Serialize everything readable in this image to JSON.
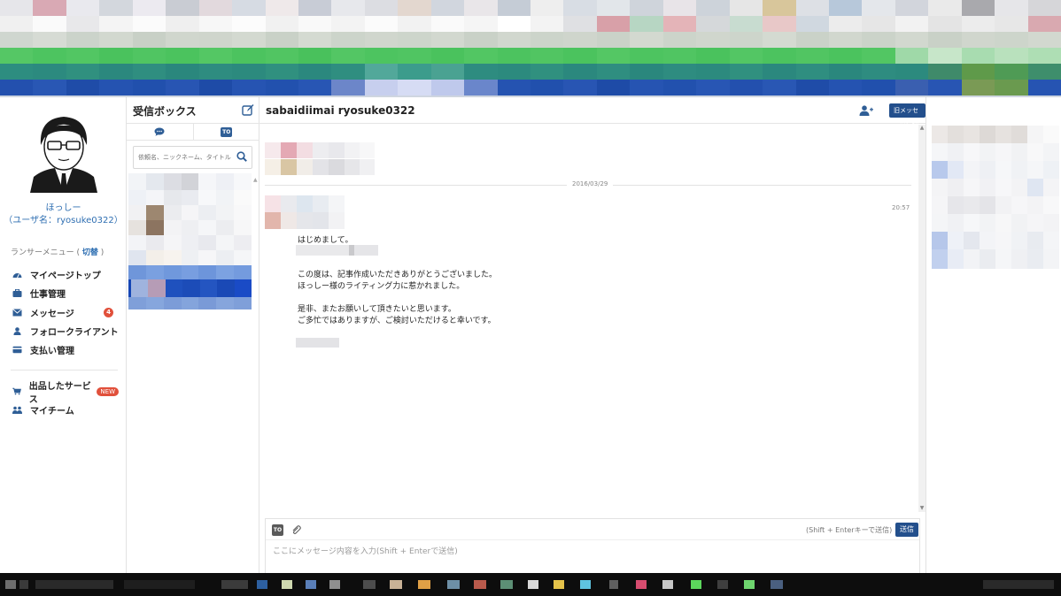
{
  "user": {
    "display_name": "ほっしー",
    "username_line": "（ユーザ名：ryosuke0322）"
  },
  "menu": {
    "heading_prefix": "ランサーメニュー (",
    "switch_label": "切替",
    "heading_suffix": ")",
    "items": [
      {
        "label": "マイページトップ",
        "icon": "dashboard-icon"
      },
      {
        "label": "仕事管理",
        "icon": "briefcase-icon"
      },
      {
        "label": "メッセージ",
        "icon": "envelope-icon",
        "badge": "4"
      },
      {
        "label": "フォロークライアント",
        "icon": "user-icon"
      },
      {
        "label": "支払い管理",
        "icon": "credit-card-icon"
      }
    ],
    "items2": [
      {
        "label": "出品したサービス",
        "icon": "cart-icon",
        "badge": "NEW"
      },
      {
        "label": "マイチーム",
        "icon": "users-icon"
      }
    ]
  },
  "inbox": {
    "title": "受信ボックス",
    "tab_to_label": "TO",
    "search_placeholder": "依頼名、ニックネーム、タイトル"
  },
  "chat": {
    "title": "sabaidiimai ryosuke0322",
    "old_message_button": "旧メッセージに切替",
    "date": "2016/03/29",
    "time": "20:57",
    "lines": [
      "はじめまして。",
      "この度は、記事作成いただきありがとうございました。",
      "ほっしー様のライティング力に惹かれました。",
      "是非、またお願いして頂きたいと思います。",
      "ご多忙ではありますが、ご検討いただけると幸いです。"
    ]
  },
  "composer": {
    "to_label": "TO",
    "send_hint": "(Shift + Enterキーで送信)",
    "send_label": "送信",
    "placeholder": "ここにメッセージ内容を入力(Shift + Enterで送信)"
  },
  "colors": {
    "accent": "#234f8c",
    "link": "#2f6fb2",
    "badge": "#e1503b",
    "selected_row": "#1546b5"
  }
}
